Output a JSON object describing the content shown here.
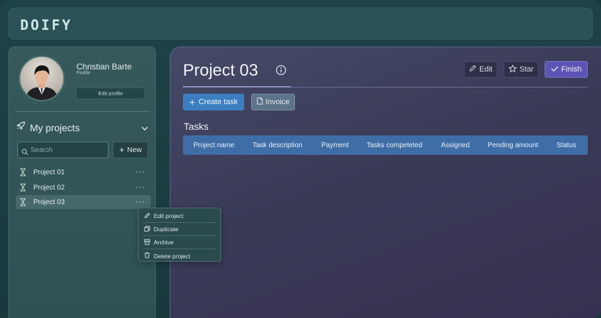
{
  "app": {
    "logo": "DOIFY"
  },
  "user": {
    "name": "Christian Barte",
    "role": "Profile",
    "edit_label": "Edit profile"
  },
  "projects": {
    "heading": "My projects",
    "search_placeholder": "Search",
    "new_label": "New",
    "items": [
      {
        "label": "Project 01",
        "menu": "···"
      },
      {
        "label": "Project 02",
        "menu": "···"
      },
      {
        "label": "Project 03",
        "menu": "···"
      }
    ],
    "context_menu": [
      {
        "label": "Edit project",
        "icon": "pencil-icon"
      },
      {
        "label": "Duplicate",
        "icon": "copy-icon"
      },
      {
        "label": "Archive",
        "icon": "archive-icon"
      },
      {
        "label": "Delete project",
        "icon": "trash-icon"
      }
    ]
  },
  "main": {
    "title": "Project 03",
    "actions": {
      "edit": "Edit",
      "star": "Star",
      "finish": "Finish"
    },
    "create_task": "Create task",
    "invoice": "Invoice",
    "tasks_title": "Tasks",
    "columns": [
      "Project name",
      "Task description",
      "Payment",
      "Tasks compeleted",
      "Assigned",
      "Pending amount",
      "Status"
    ]
  },
  "colors": {
    "accent_blue": "#3b7fc1",
    "finish_purple": "#5c55b4",
    "sidebar_bg": "#36595b",
    "main_bg": "#3a3a57"
  }
}
